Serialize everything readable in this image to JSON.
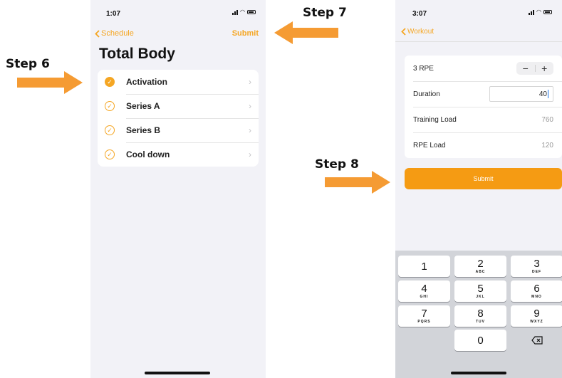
{
  "steps": {
    "step6": "Step 6",
    "step7": "Step 7",
    "step8": "Step 8"
  },
  "colors": {
    "accent": "#f5a623",
    "arrow": "#f59b33",
    "submit": "#f59b13"
  },
  "phone1": {
    "time": "1:07",
    "back_label": "Schedule",
    "submit_label": "Submit",
    "title": "Total Body",
    "items": [
      {
        "label": "Activation",
        "state": "complete"
      },
      {
        "label": "Series A",
        "state": "incomplete"
      },
      {
        "label": "Series B",
        "state": "incomplete"
      },
      {
        "label": "Cool down",
        "state": "incomplete"
      }
    ]
  },
  "phone2": {
    "time": "3:07",
    "back_label": "Workout",
    "rpe_label": "3 RPE",
    "stepper_minus": "−",
    "stepper_plus": "+",
    "duration_label": "Duration",
    "duration_value": "40",
    "training_load_label": "Training Load",
    "training_load_value": "760",
    "rpe_load_label": "RPE Load",
    "rpe_load_value": "120",
    "submit_label": "Submit"
  },
  "keypad": [
    {
      "num": "1",
      "letters": ""
    },
    {
      "num": "2",
      "letters": "ABC"
    },
    {
      "num": "3",
      "letters": "DEF"
    },
    {
      "num": "4",
      "letters": "GHI"
    },
    {
      "num": "5",
      "letters": "JKL"
    },
    {
      "num": "6",
      "letters": "MNO"
    },
    {
      "num": "7",
      "letters": "PQRS"
    },
    {
      "num": "8",
      "letters": "TUV"
    },
    {
      "num": "9",
      "letters": "WXYZ"
    },
    {
      "num": "0",
      "letters": ""
    }
  ],
  "icons": {
    "back": "chevron-left-icon",
    "row": "chevron-right-icon",
    "check": "checkmark-circle-icon",
    "delete": "backspace-icon"
  }
}
